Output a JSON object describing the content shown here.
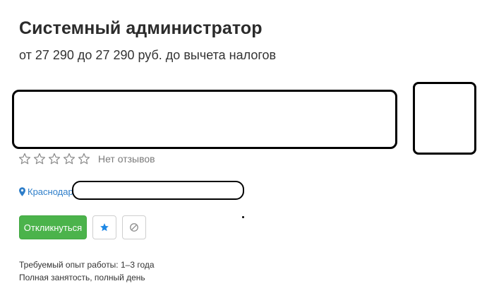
{
  "vacancy": {
    "title": "Системный администратор",
    "salary": "от 27 290 до 27 290 руб. до вычета налогов"
  },
  "employer": {
    "rating_stars": 0,
    "rating_max": 5,
    "reviews_label": "Нет отзывов"
  },
  "location": {
    "city": "Краснодар,",
    "icon": "map-pin-icon",
    "color": "#2e7ec9"
  },
  "actions": {
    "apply_label": "Откликнуться",
    "apply_color": "#4bb34b",
    "favorite_icon": "star-icon",
    "favorite_color": "#1e88e5",
    "hide_icon": "block-icon"
  },
  "details": {
    "experience": "Требуемый опыт работы: 1–3 года",
    "employment": "Полная занятость, полный день"
  }
}
